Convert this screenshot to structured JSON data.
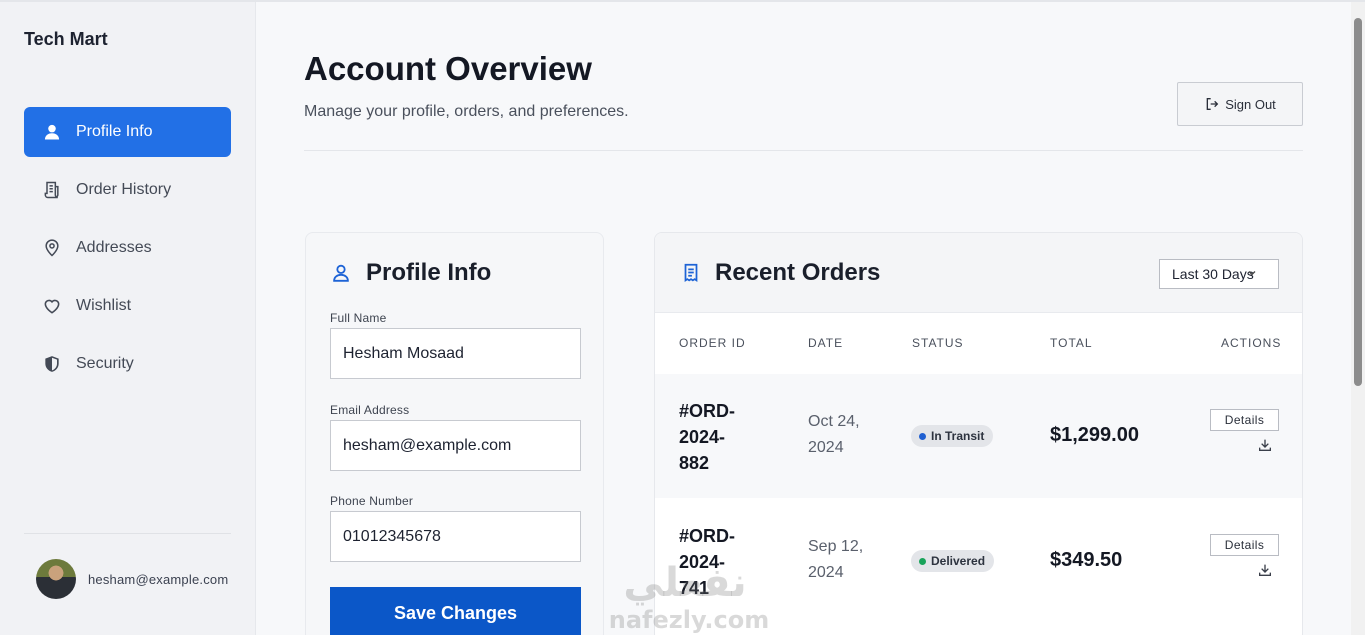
{
  "brand": "Tech Mart",
  "sidebar": {
    "items": [
      {
        "label": "Profile Info",
        "icon": "user-icon",
        "active": true
      },
      {
        "label": "Order History",
        "icon": "receipt-icon",
        "active": false
      },
      {
        "label": "Addresses",
        "icon": "map-pin-icon",
        "active": false
      },
      {
        "label": "Wishlist",
        "icon": "heart-icon",
        "active": false
      },
      {
        "label": "Security",
        "icon": "shield-icon",
        "active": false
      }
    ],
    "user_email": "hesham@example.com"
  },
  "header": {
    "title": "Account Overview",
    "subtitle": "Manage your profile, orders, and preferences.",
    "signout_label": "Sign Out"
  },
  "profile": {
    "title": "Profile Info",
    "fields": [
      {
        "label": "Full Name",
        "value": "Hesham Mosaad"
      },
      {
        "label": "Email Address",
        "value": "hesham@example.com"
      },
      {
        "label": "Phone Number",
        "value": "01012345678"
      }
    ],
    "save_label": "Save Changes"
  },
  "orders": {
    "title": "Recent Orders",
    "range": "Last 30 Days",
    "columns": [
      "ORDER ID",
      "DATE",
      "STATUS",
      "TOTAL",
      "ACTIONS"
    ],
    "rows": [
      {
        "id": "#ORD-2024-882",
        "date": "Oct 24, 2024",
        "status": "In Transit",
        "status_color": "#1f5fd1",
        "total": "$1,299.00",
        "action": "Details"
      },
      {
        "id": "#ORD-2024-741",
        "date": "Sep 12, 2024",
        "status": "Delivered",
        "status_color": "#19a35a",
        "total": "$349.50",
        "action": "Details"
      }
    ]
  },
  "watermark": {
    "arabic": "نفعلي",
    "latin": "nafezly.com"
  },
  "colors": {
    "accent": "#2270e6",
    "primary_button": "#0b57c8"
  }
}
